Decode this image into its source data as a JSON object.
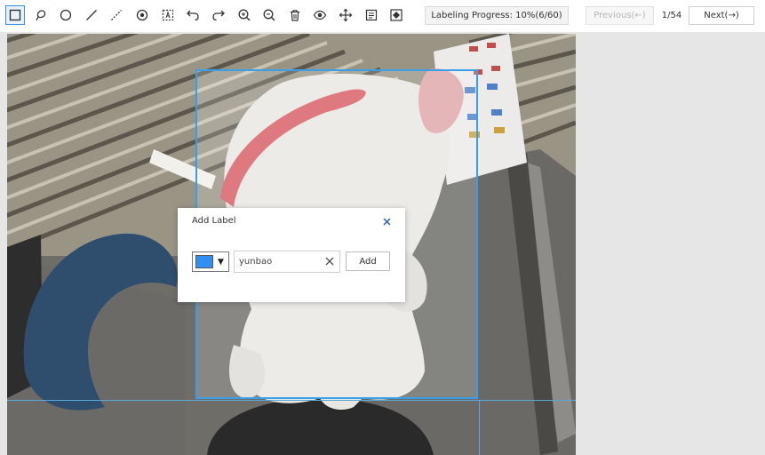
{
  "toolbar": {
    "tools": [
      {
        "name": "rectangle-icon",
        "active": true
      },
      {
        "name": "lasso-icon"
      },
      {
        "name": "circle-icon"
      },
      {
        "name": "line-icon"
      },
      {
        "name": "dashed-line-icon"
      },
      {
        "name": "point-icon"
      },
      {
        "name": "text-box-icon"
      },
      {
        "name": "undo-icon"
      },
      {
        "name": "redo-icon"
      },
      {
        "name": "zoom-in-icon"
      },
      {
        "name": "zoom-out-icon"
      },
      {
        "name": "delete-icon"
      },
      {
        "name": "eye-icon"
      },
      {
        "name": "move-icon"
      },
      {
        "name": "label-list-icon"
      },
      {
        "name": "fit-screen-icon"
      }
    ],
    "progress_text": "Labeling Progress: 10%(6/60)",
    "prev_label": "Previous(←)",
    "page_indicator": "1/54",
    "next_label": "Next(→)"
  },
  "dialog": {
    "title": "Add Label",
    "selected_color": "#2f8ff2",
    "input_value": "yunbao",
    "add_label": "Add"
  },
  "colors": {
    "accent": "#3a9fe8",
    "toolbar_bg": "#ffffff",
    "workspace_bg": "#e6e6e6"
  }
}
